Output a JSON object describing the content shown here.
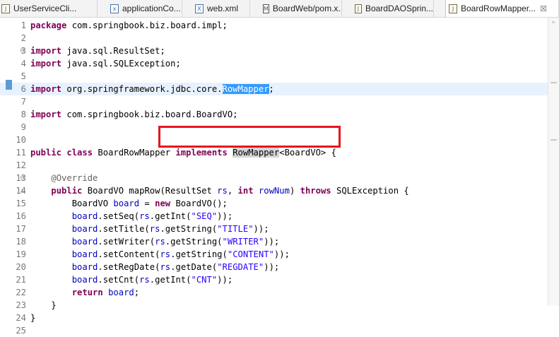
{
  "tabs": [
    {
      "label": "UserServiceCli...",
      "icon": "java-file-icon",
      "active": false
    },
    {
      "label": "applicationCo...",
      "icon": "spring-xml-file-icon",
      "active": false
    },
    {
      "label": "web.xml",
      "icon": "xml-file-icon",
      "active": false
    },
    {
      "label": "BoardWeb/pom.x...",
      "icon": "maven-pom-icon",
      "active": false
    },
    {
      "label": "BoardDAOSprin...",
      "icon": "java-file-icon",
      "active": false
    },
    {
      "label": "BoardRowMapper...",
      "icon": "java-file-icon",
      "active": true,
      "close": "☒"
    }
  ],
  "editor": {
    "lines": [
      {
        "n": "1",
        "parts": [
          [
            "kw",
            "package"
          ],
          [
            "",
            "com.springbook.biz.board.impl;"
          ]
        ]
      },
      {
        "n": "2",
        "parts": []
      },
      {
        "n": "3",
        "fold": "⊟",
        "parts": [
          [
            "kw",
            "import"
          ],
          [
            "",
            "java.sql.ResultSet;"
          ]
        ]
      },
      {
        "n": "4",
        "parts": [
          [
            "kw",
            "import"
          ],
          [
            "",
            "java.sql.SQLException;"
          ]
        ]
      },
      {
        "n": "5",
        "parts": []
      },
      {
        "n": "6",
        "hl": true,
        "parts": [
          [
            "kw",
            "import"
          ],
          [
            "",
            "org.springframework.jdbc.core."
          ],
          [
            "sel",
            "RowMapper"
          ],
          [
            "",
            ";"
          ]
        ]
      },
      {
        "n": "7",
        "parts": []
      },
      {
        "n": "8",
        "parts": [
          [
            "kw",
            "import"
          ],
          [
            "",
            "com.springbook.biz.board.BoardVO;"
          ]
        ]
      },
      {
        "n": "9",
        "parts": []
      },
      {
        "n": "10",
        "parts": []
      },
      {
        "n": "11",
        "parts": [
          [
            "kw",
            "public"
          ],
          [
            "",
            ""
          ],
          [
            "kw",
            "class"
          ],
          [
            "",
            "BoardRowMapper"
          ],
          [
            "kw",
            "implements"
          ],
          [
            "",
            ""
          ],
          [
            "occ",
            "RowMapper"
          ],
          [
            "",
            "<BoardVO> {"
          ]
        ]
      },
      {
        "n": "12",
        "parts": []
      },
      {
        "n": "13",
        "fold": "⊟",
        "parts": [
          [
            "",
            "    "
          ],
          [
            "ann",
            "@Override"
          ]
        ]
      },
      {
        "n": "14",
        "fold": "△",
        "parts": [
          [
            "",
            "    "
          ],
          [
            "kw",
            "public"
          ],
          [
            "",
            "BoardVO mapRow(ResultSet "
          ],
          [
            "fld",
            "rs"
          ],
          [
            "",
            ", "
          ],
          [
            "kw",
            "int"
          ],
          [
            "",
            ""
          ],
          [
            "fld",
            "rowNum"
          ],
          [
            "",
            ")"
          ],
          [
            "kw",
            "throws"
          ],
          [
            "",
            "SQLException {"
          ]
        ]
      },
      {
        "n": "15",
        "parts": [
          [
            "",
            "        BoardVO "
          ],
          [
            "fld",
            "board"
          ],
          [
            "",
            " = "
          ],
          [
            "kw",
            "new"
          ],
          [
            "",
            "BoardVO();"
          ]
        ]
      },
      {
        "n": "16",
        "parts": [
          [
            "",
            "        "
          ],
          [
            "fld",
            "board"
          ],
          [
            "",
            ".setSeq("
          ],
          [
            "fld",
            "rs"
          ],
          [
            "",
            ".getInt("
          ],
          [
            "str",
            "\"SEQ\""
          ],
          [
            "",
            "));"
          ]
        ]
      },
      {
        "n": "17",
        "parts": [
          [
            "",
            "        "
          ],
          [
            "fld",
            "board"
          ],
          [
            "",
            ".setTitle("
          ],
          [
            "fld",
            "rs"
          ],
          [
            "",
            ".getString("
          ],
          [
            "str",
            "\"TITLE\""
          ],
          [
            "",
            "));"
          ]
        ]
      },
      {
        "n": "18",
        "parts": [
          [
            "",
            "        "
          ],
          [
            "fld",
            "board"
          ],
          [
            "",
            ".setWriter("
          ],
          [
            "fld",
            "rs"
          ],
          [
            "",
            ".getString("
          ],
          [
            "str",
            "\"WRITER\""
          ],
          [
            "",
            "));"
          ]
        ]
      },
      {
        "n": "19",
        "parts": [
          [
            "",
            "        "
          ],
          [
            "fld",
            "board"
          ],
          [
            "",
            ".setContent("
          ],
          [
            "fld",
            "rs"
          ],
          [
            "",
            ".getString("
          ],
          [
            "str",
            "\"CONTENT\""
          ],
          [
            "",
            "));"
          ]
        ]
      },
      {
        "n": "20",
        "parts": [
          [
            "",
            "        "
          ],
          [
            "fld",
            "board"
          ],
          [
            "",
            ".setRegDate("
          ],
          [
            "fld",
            "rs"
          ],
          [
            "",
            ".getDate("
          ],
          [
            "str",
            "\"REGDATE\""
          ],
          [
            "",
            "));"
          ]
        ]
      },
      {
        "n": "21",
        "parts": [
          [
            "",
            "        "
          ],
          [
            "fld",
            "board"
          ],
          [
            "",
            ".setCnt("
          ],
          [
            "fld",
            "rs"
          ],
          [
            "",
            ".getInt("
          ],
          [
            "str",
            "\"CNT\""
          ],
          [
            "",
            "));"
          ]
        ]
      },
      {
        "n": "22",
        "parts": [
          [
            "",
            "        "
          ],
          [
            "kw",
            "return"
          ],
          [
            "",
            ""
          ],
          [
            "fld",
            "board"
          ],
          [
            "",
            ";"
          ]
        ]
      },
      {
        "n": "23",
        "parts": [
          [
            "",
            "    }"
          ]
        ]
      },
      {
        "n": "24",
        "parts": [
          [
            "",
            "}"
          ]
        ]
      },
      {
        "n": "25",
        "parts": []
      }
    ]
  },
  "colors": {
    "keyword": "#7f0055",
    "string": "#2a00ff",
    "annotation": "#646464",
    "field": "#0000c0",
    "highlight_box": "#e5161d"
  }
}
